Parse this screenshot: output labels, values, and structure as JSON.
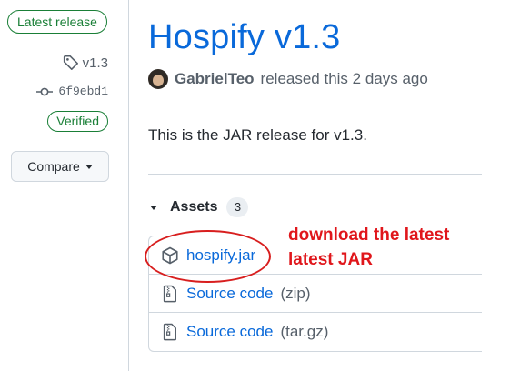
{
  "sidebar": {
    "latest_badge": "Latest release",
    "tag": "v1.3",
    "commit": "6f9ebd1",
    "verified_badge": "Verified",
    "compare_label": "Compare"
  },
  "release": {
    "title": "Hospify v1.3",
    "author": "GabrielTeo",
    "released_text": "released this 2 days ago",
    "body": "This is the JAR release for v1.3."
  },
  "assets": {
    "header": "Assets",
    "count": "3",
    "items": [
      {
        "name": "hospify.jar",
        "suffix": "",
        "icon": "package-icon"
      },
      {
        "name": "Source code",
        "suffix": "(zip)",
        "icon": "file-zip-icon"
      },
      {
        "name": "Source code",
        "suffix": "(tar.gz)",
        "icon": "file-zip-icon"
      }
    ]
  },
  "annotation": {
    "line1": "download the latest",
    "line2": "latest JAR",
    "color": "#e0161b"
  },
  "colors": {
    "link": "#0969da",
    "success": "#1a7f37",
    "muted": "#57606a",
    "border": "#d0d7de"
  }
}
